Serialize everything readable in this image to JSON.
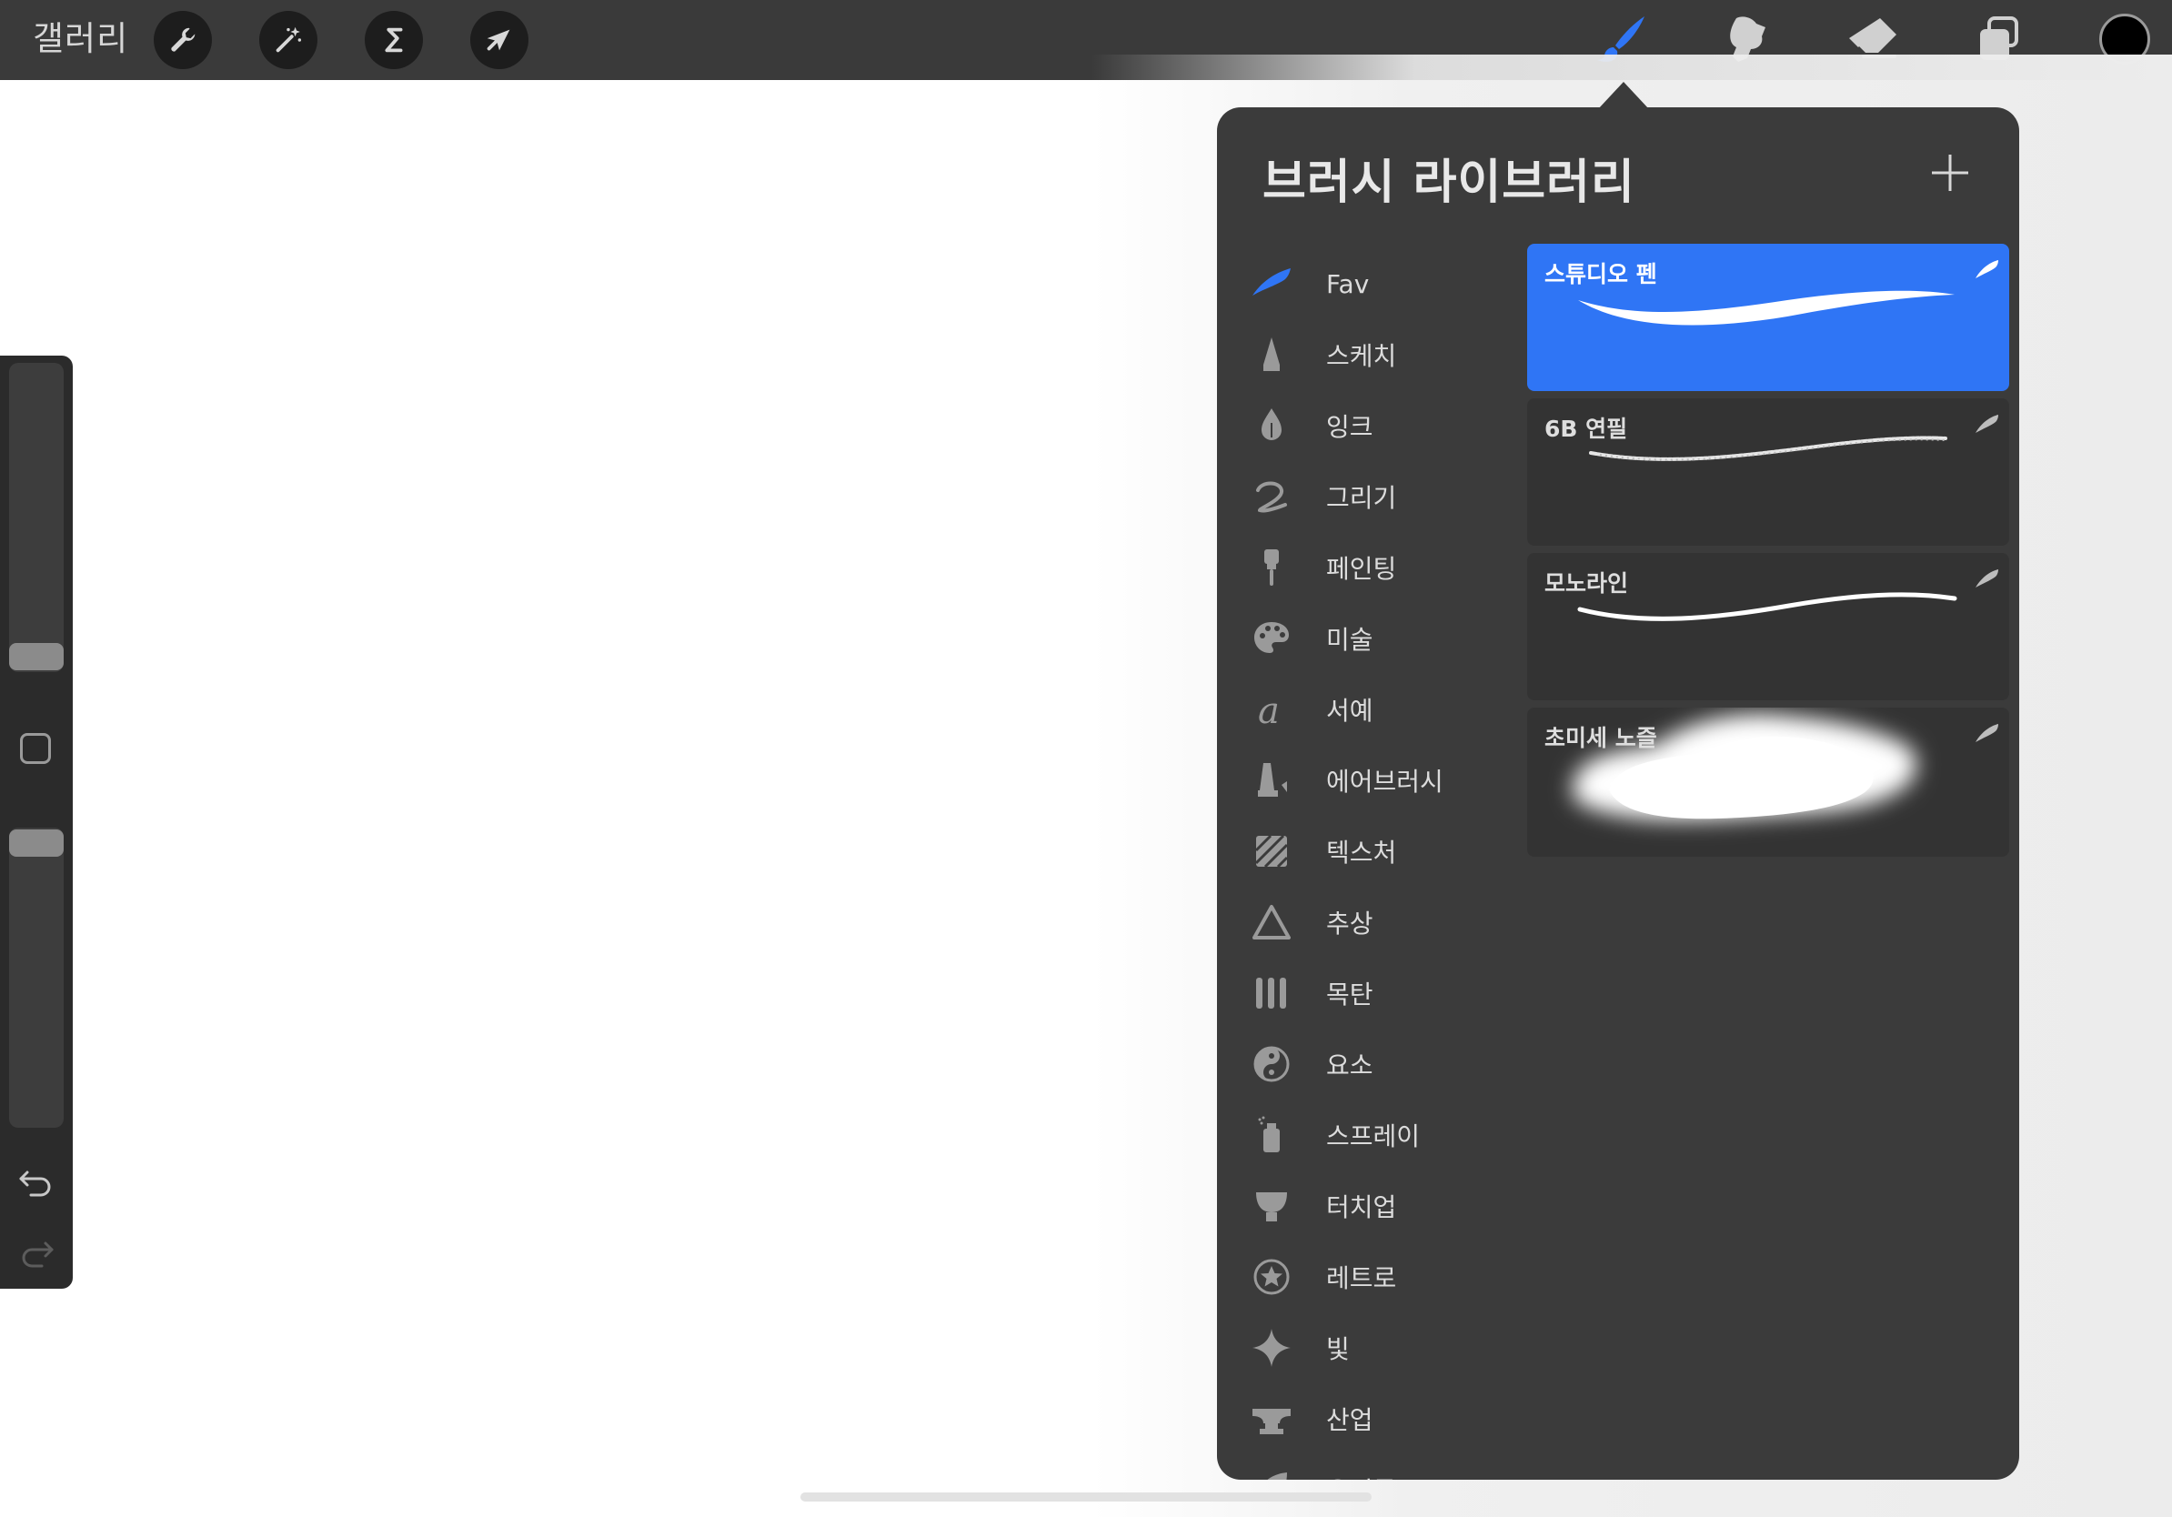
{
  "toolbar": {
    "gallery_label": "갤러리",
    "left_tools": [
      {
        "name": "actions-wrench-icon"
      },
      {
        "name": "adjustments-magic-wand-icon"
      },
      {
        "name": "selection-s-icon"
      },
      {
        "name": "transform-arrow-icon"
      }
    ],
    "right_tools": [
      {
        "name": "brush-icon",
        "active": true
      },
      {
        "name": "smudge-icon"
      },
      {
        "name": "eraser-icon"
      },
      {
        "name": "layers-icon"
      }
    ],
    "current_color": "#000000",
    "active_color": "#2f75f5"
  },
  "sidebar": {
    "brush_size_level": 0.05,
    "opacity_level": 0.95,
    "modify_button": "square-modify-icon",
    "undo": "undo-arrow-icon",
    "redo": "redo-arrow-icon"
  },
  "brush_library": {
    "title": "브러시 라이브러리",
    "add_icon": "plus-icon",
    "categories": [
      {
        "label": "Fav",
        "icon": "feather-stroke-icon",
        "selected": true
      },
      {
        "label": "스케치",
        "icon": "pencil-tip-icon"
      },
      {
        "label": "잉크",
        "icon": "ink-drop-icon"
      },
      {
        "label": "그리기",
        "icon": "squiggle-icon"
      },
      {
        "label": "페인팅",
        "icon": "paintbrush-icon"
      },
      {
        "label": "미술",
        "icon": "palette-icon"
      },
      {
        "label": "서예",
        "icon": "calligraphy-a-icon"
      },
      {
        "label": "에어브러시",
        "icon": "airbrush-icon"
      },
      {
        "label": "텍스처",
        "icon": "texture-icon"
      },
      {
        "label": "추상",
        "icon": "triangle-icon"
      },
      {
        "label": "목탄",
        "icon": "charcoal-sticks-icon"
      },
      {
        "label": "요소",
        "icon": "yin-yang-icon"
      },
      {
        "label": "스프레이",
        "icon": "spray-can-icon"
      },
      {
        "label": "터치업",
        "icon": "touchup-brush-icon"
      },
      {
        "label": "레트로",
        "icon": "star-circle-icon"
      },
      {
        "label": "빛",
        "icon": "sparkle-icon"
      },
      {
        "label": "산업",
        "icon": "anvil-icon"
      },
      {
        "label": "유기물",
        "icon": "leaf-icon"
      }
    ],
    "brushes": [
      {
        "name": "스튜디오 펜",
        "selected": true,
        "stroke": "studio-pen"
      },
      {
        "name": "6B 연필",
        "selected": false,
        "stroke": "pencil"
      },
      {
        "name": "모노라인",
        "selected": false,
        "stroke": "monoline"
      },
      {
        "name": "초미세 노즐",
        "selected": false,
        "stroke": "nozzle-spray"
      }
    ]
  }
}
